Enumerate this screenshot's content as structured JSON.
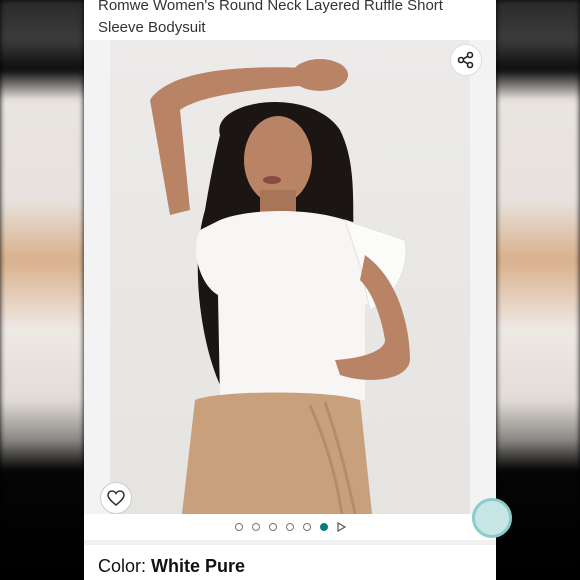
{
  "product": {
    "title_line1": "Romwe Women's Round Neck Layered Ruffle Short",
    "title_line2": "Sleeve Bodysuit"
  },
  "gallery": {
    "image_count": 7,
    "active_index": 6,
    "share_icon": "share-icon",
    "wishlist_icon": "heart-icon",
    "play_icon": "play-icon"
  },
  "variant": {
    "label": "Color:",
    "value": "White Pure"
  },
  "colors": {
    "accent": "#067d7d",
    "skirt": "#c9a07c",
    "top": "#f7f6f4"
  }
}
